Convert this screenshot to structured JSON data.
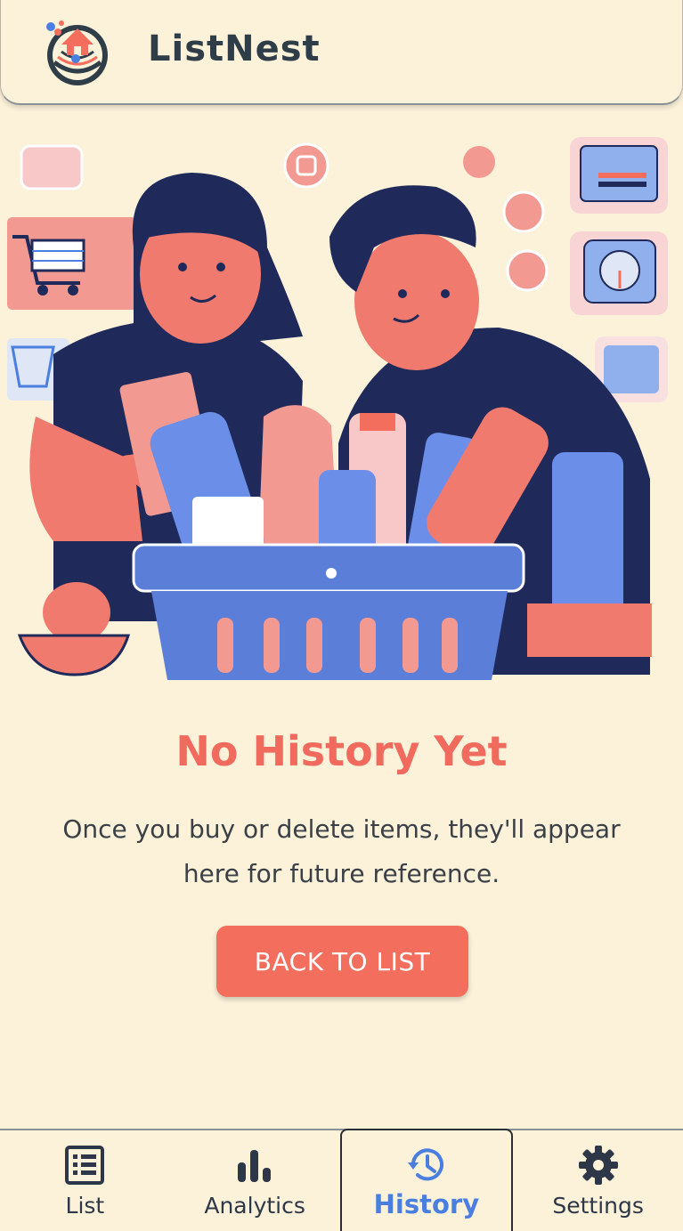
{
  "app": {
    "title": "ListNest"
  },
  "empty_state": {
    "title": "No History Yet",
    "description": "Once you buy or delete items, they'll appear here for future reference.",
    "button_label": "BACK TO LIST"
  },
  "nav": {
    "items": [
      {
        "label": "List",
        "icon": "list-icon"
      },
      {
        "label": "Analytics",
        "icon": "bar-chart-icon"
      },
      {
        "label": "History",
        "icon": "history-icon",
        "active": true
      },
      {
        "label": "Settings",
        "icon": "gear-icon"
      }
    ]
  },
  "colors": {
    "background": "#fcf2da",
    "accent": "#f46e5e",
    "active_nav": "#4a7fe0",
    "dark_text": "#2e3d48"
  }
}
